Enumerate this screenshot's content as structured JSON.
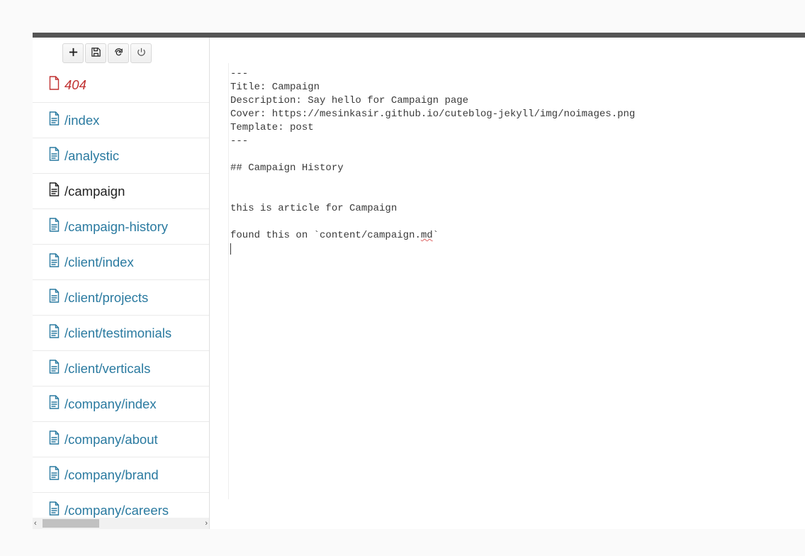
{
  "toolbar": {
    "new_label": "New",
    "save_label": "Save",
    "refresh_label": "Refresh",
    "power_label": "Power"
  },
  "sidebar": {
    "items": [
      {
        "label": "404",
        "variant": "error"
      },
      {
        "label": "/index",
        "variant": "normal"
      },
      {
        "label": "/analystic",
        "variant": "normal"
      },
      {
        "label": "/campaign",
        "variant": "active"
      },
      {
        "label": "/campaign-history",
        "variant": "normal"
      },
      {
        "label": "/client/index",
        "variant": "normal"
      },
      {
        "label": "/client/projects",
        "variant": "normal"
      },
      {
        "label": "/client/testimonials",
        "variant": "normal"
      },
      {
        "label": "/client/verticals",
        "variant": "normal"
      },
      {
        "label": "/company/index",
        "variant": "normal"
      },
      {
        "label": "/company/about",
        "variant": "normal"
      },
      {
        "label": "/company/brand",
        "variant": "normal"
      },
      {
        "label": "/company/careers",
        "variant": "normal"
      }
    ]
  },
  "editor": {
    "lines": [
      "---",
      "Title: Campaign",
      "Description: Say hello for Campaign page",
      "Cover: https://mesinkasir.github.io/cuteblog-jekyll/img/noimages.png",
      "Template: post",
      "---",
      "",
      "## Campaign History",
      "",
      "",
      "this is article for Campaign",
      "",
      "found this on `content/campaign.md`"
    ],
    "spellcheck_token": "md",
    "spellcheck_line": 12
  }
}
